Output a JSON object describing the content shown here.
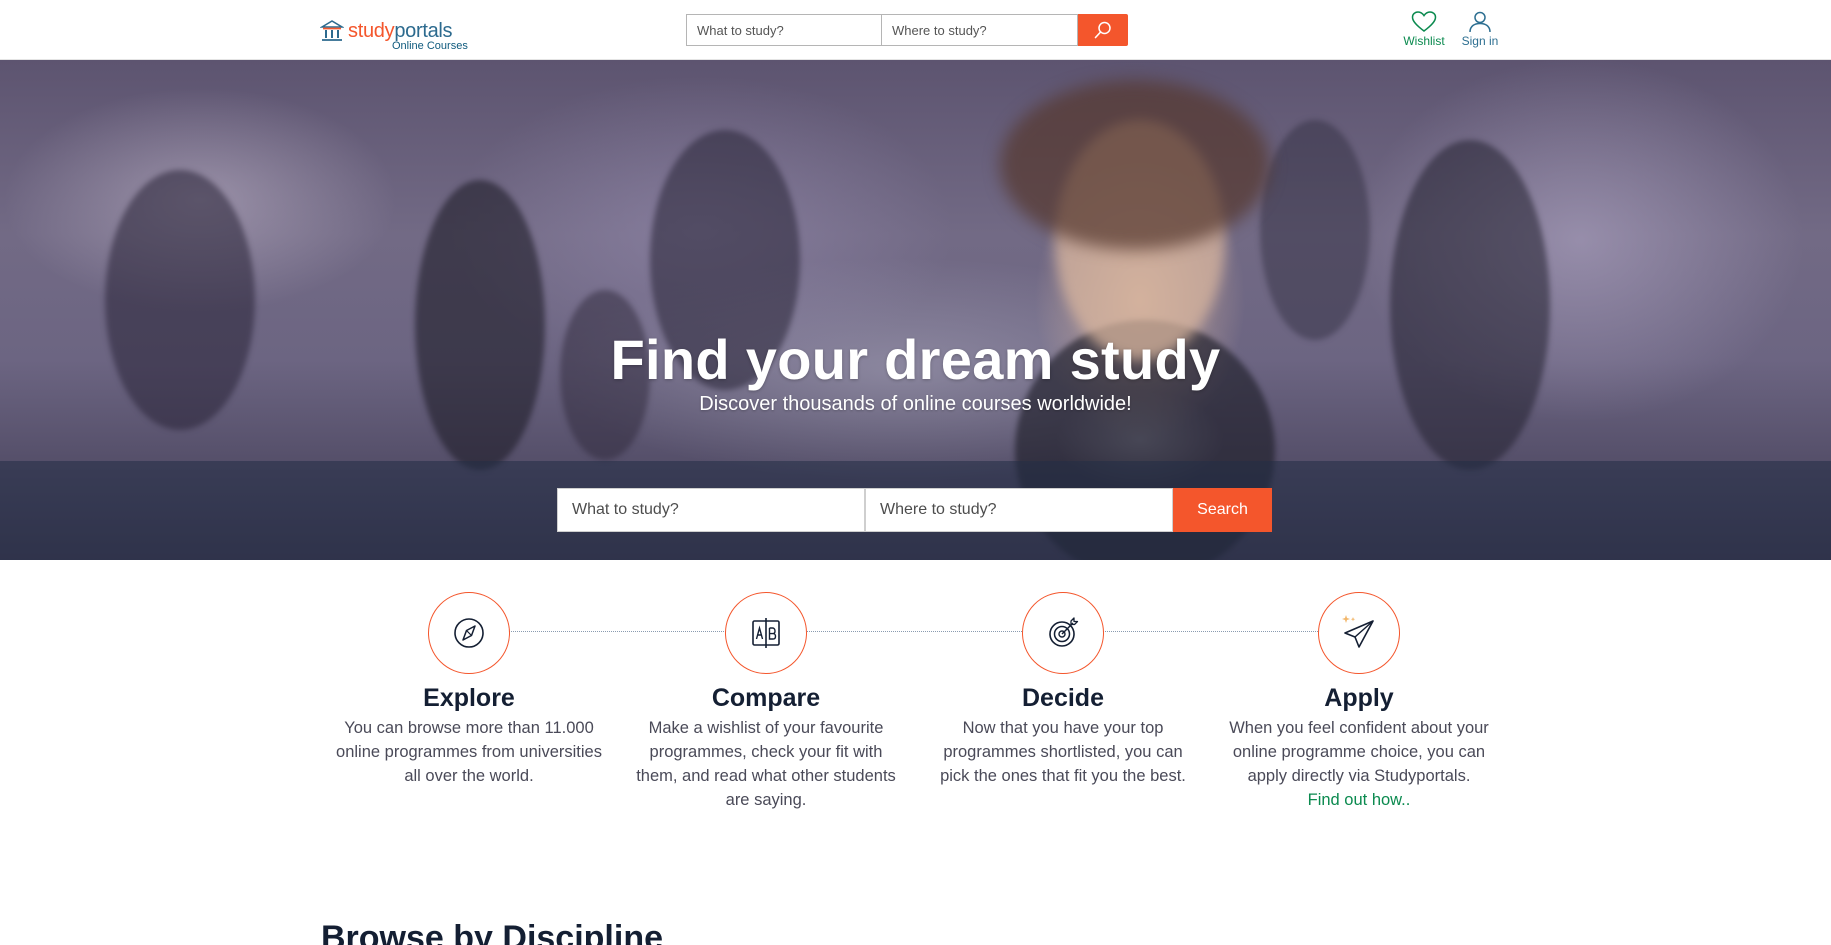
{
  "header": {
    "logo": {
      "word_part1": "study",
      "word_part2": "portals",
      "subtitle": "Online Courses"
    },
    "search": {
      "what_placeholder": "What to study?",
      "where_placeholder": "Where to study?",
      "button_icon": "search-icon"
    },
    "wishlist_label": "Wishlist",
    "signin_label": "Sign in"
  },
  "hero": {
    "title": "Find your dream study",
    "subtitle": "Discover thousands of online courses worldwide!",
    "search": {
      "what_placeholder": "What to study?",
      "where_placeholder": "Where to study?",
      "button_label": "Search"
    }
  },
  "steps": [
    {
      "title": "Explore",
      "text": "You can browse more than 11.000 online programmes from universities all over the world.",
      "icon": "compass-icon"
    },
    {
      "title": "Compare",
      "text": "Make a wishlist of your favourite programmes, check your fit with them, and read what other students are saying.",
      "icon": "compare-icon"
    },
    {
      "title": "Decide",
      "text": "Now that you have your top programmes shortlisted, you can pick the ones that fit you the best.",
      "icon": "target-icon"
    },
    {
      "title": "Apply",
      "text": "When you feel confident about your online programme choice, you can apply directly via Studyportals.",
      "link": "Find out how..",
      "icon": "paper-plane-icon"
    }
  ],
  "browse": {
    "title": "Browse by Discipline"
  },
  "colors": {
    "accent": "#f4562c",
    "brand_blue": "#2c6a8e",
    "link_green": "#0b8a4f",
    "heading_dark": "#141f33"
  }
}
